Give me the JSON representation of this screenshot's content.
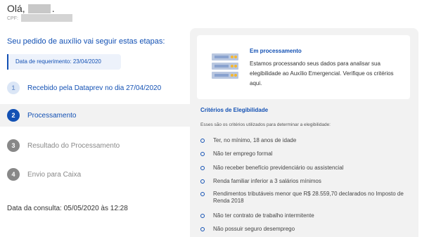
{
  "header": {
    "greeting": "Olá,",
    "greeting_punct": ".",
    "cpf_label": "CPF:"
  },
  "steps_title": "Seu pedido de auxílio vai seguir estas etapas:",
  "request_date": "Data de requerimento: 23/04/2020",
  "steps": [
    {
      "number": "1",
      "label": "Recebido pela Dataprev no dia 27/04/2020",
      "status": "done"
    },
    {
      "number": "2",
      "label": "Processamento",
      "status": "active"
    },
    {
      "number": "3",
      "label": "Resultado do Processamento",
      "status": "pending"
    },
    {
      "number": "4",
      "label": "Envio para Caixa",
      "status": "pending"
    }
  ],
  "consult_date": "Data da consulta: 05/05/2020 às 12:28",
  "status_card": {
    "icon": "server-icon",
    "title": "Em processamento",
    "text": "Estamos processando seus dados para analisar sua elegibilidade ao Auxílio Emergencial. Verifique os critérios aqui."
  },
  "criteria": {
    "title": "Critérios de Elegibilidade",
    "subtitle": "Esses são os critérios utilizados para determinar a elegibilidade:",
    "items": [
      "Ter, no mínimo, 18 anos de idade",
      "Não ter emprego formal",
      "Não receber benefício previdenciário ou assistencial",
      "Renda familiar inferior a 3 salários mínimos",
      "Rendimentos tributáveis menor que R$ 28.559,70 declarados no Imposto de Renda 2018",
      "Não ter contrato de trabalho intermitente",
      "Não possuir seguro desemprego"
    ]
  },
  "colors": {
    "primary": "#1351b4",
    "panel_bg": "#f2f2f2",
    "pending": "#888888"
  }
}
